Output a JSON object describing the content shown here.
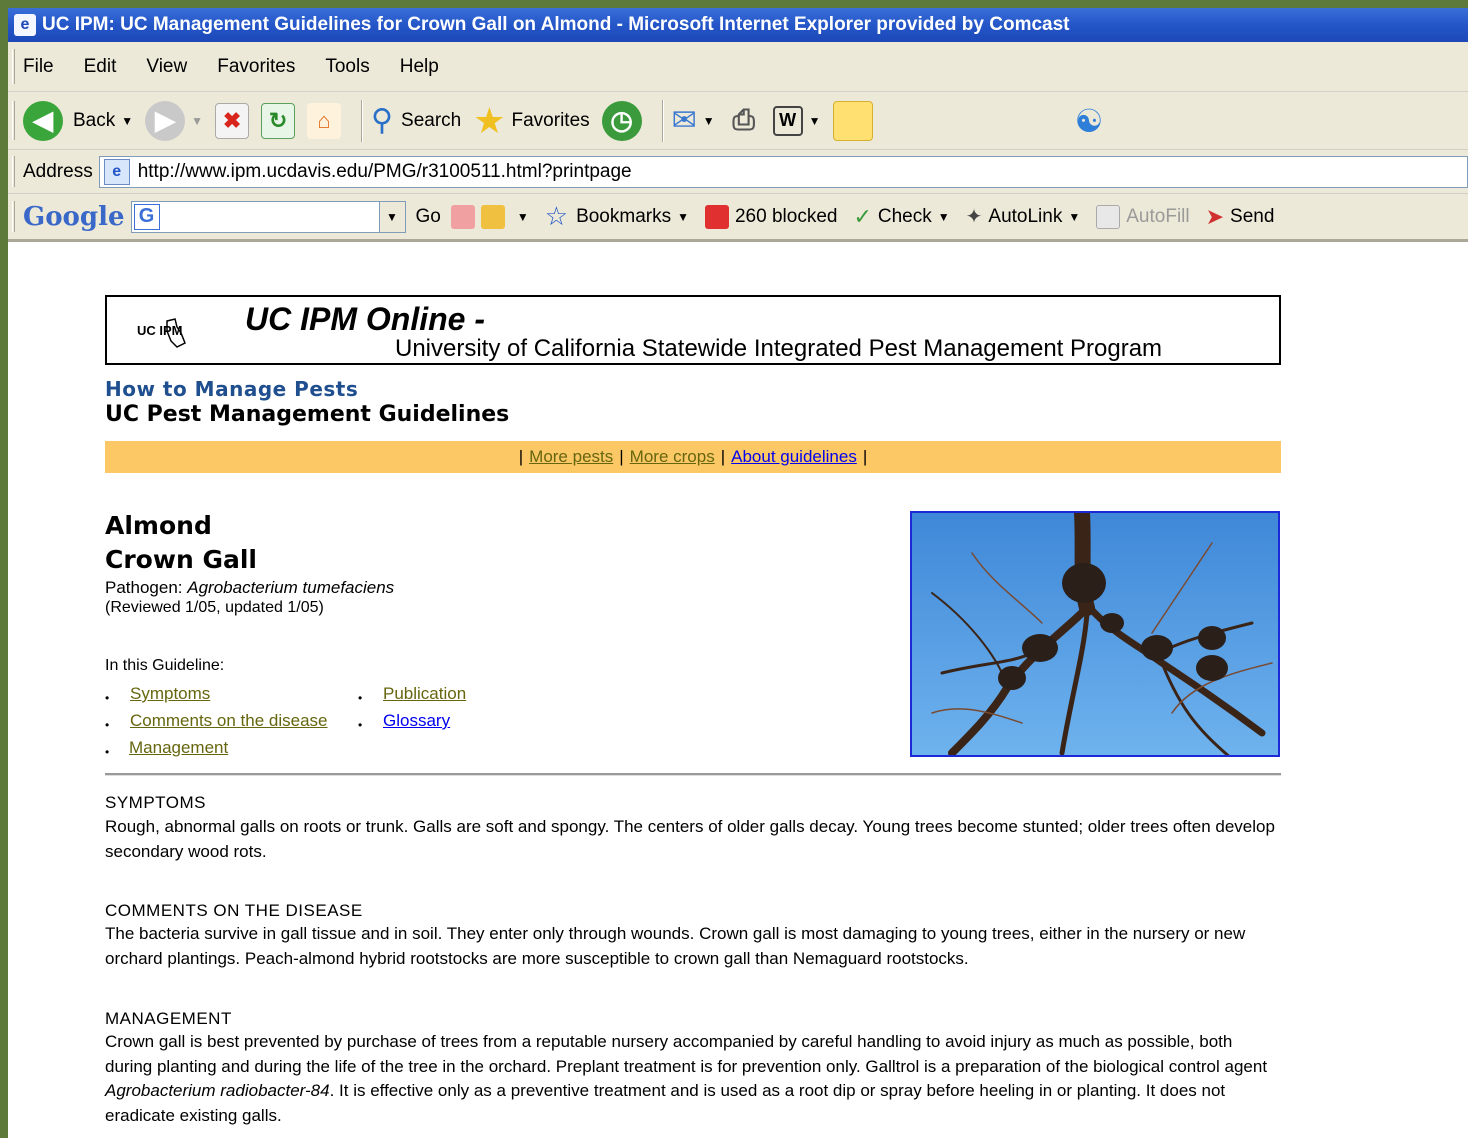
{
  "window": {
    "title": "UC IPM: UC Management Guidelines for Crown Gall on Almond - Microsoft Internet Explorer provided by Comcast"
  },
  "menu": [
    "File",
    "Edit",
    "View",
    "Favorites",
    "Tools",
    "Help"
  ],
  "toolbar": {
    "back": "Back",
    "search": "Search",
    "favorites": "Favorites"
  },
  "address": {
    "label": "Address",
    "url": "http://www.ipm.ucdavis.edu/PMG/r3100511.html?printpage"
  },
  "googlebar": {
    "logo": "Google",
    "go": "Go",
    "bookmarks": "Bookmarks",
    "blocked": "260 blocked",
    "check": "Check",
    "autolink": "AutoLink",
    "autofill": "AutoFill",
    "send": "Send"
  },
  "banner": {
    "logo": "UC IPM",
    "title": "UC IPM Online -",
    "subtitle": "University of California Statewide Integrated Pest Management Program"
  },
  "page": {
    "how_to": "How to Manage Pests",
    "guidelines": "UC Pest Management Guidelines",
    "nav": {
      "more_pests": "More pests",
      "more_crops": "More crops",
      "about": "About guidelines",
      "sep": "|"
    },
    "crop": "Almond",
    "pest": "Crown Gall",
    "pathogen_label": "Pathogen: ",
    "pathogen_name": "Agrobacterium tumefaciens",
    "reviewed": "(Reviewed 1/05, updated 1/05)",
    "in_this": "In this Guideline:",
    "links": {
      "symptoms": "Symptoms",
      "comments": "Comments on the disease",
      "management": "Management",
      "publication": "Publication",
      "glossary": "Glossary"
    },
    "symptoms_h": "SYMPTOMS",
    "symptoms_p": "Rough, abnormal galls on roots or trunk. Galls are soft and spongy. The centers of older galls decay. Young trees become stunted; older trees often develop secondary wood rots.",
    "comments_h": "COMMENTS ON THE DISEASE",
    "comments_p": "The bacteria survive in gall tissue and in soil. They enter only through wounds. Crown gall is most damaging to young trees, either in the nursery or new orchard plantings. Peach-almond hybrid rootstocks are more susceptible to crown gall than Nemaguard rootstocks.",
    "management_h": "MANAGEMENT",
    "management_p1": "Crown gall is best prevented by purchase of trees from a reputable nursery accompanied by careful handling to avoid injury as much as possible, both during planting and during the life of the tree in the orchard. Preplant treatment is for prevention only. Galltrol is a preparation of the biological control agent ",
    "management_em": "Agrobacterium radiobacter-84",
    "management_p2": ". It is effective only as a preventive treatment and is used as a root dip or spray before heeling in or planting. It does not eradicate existing galls."
  }
}
